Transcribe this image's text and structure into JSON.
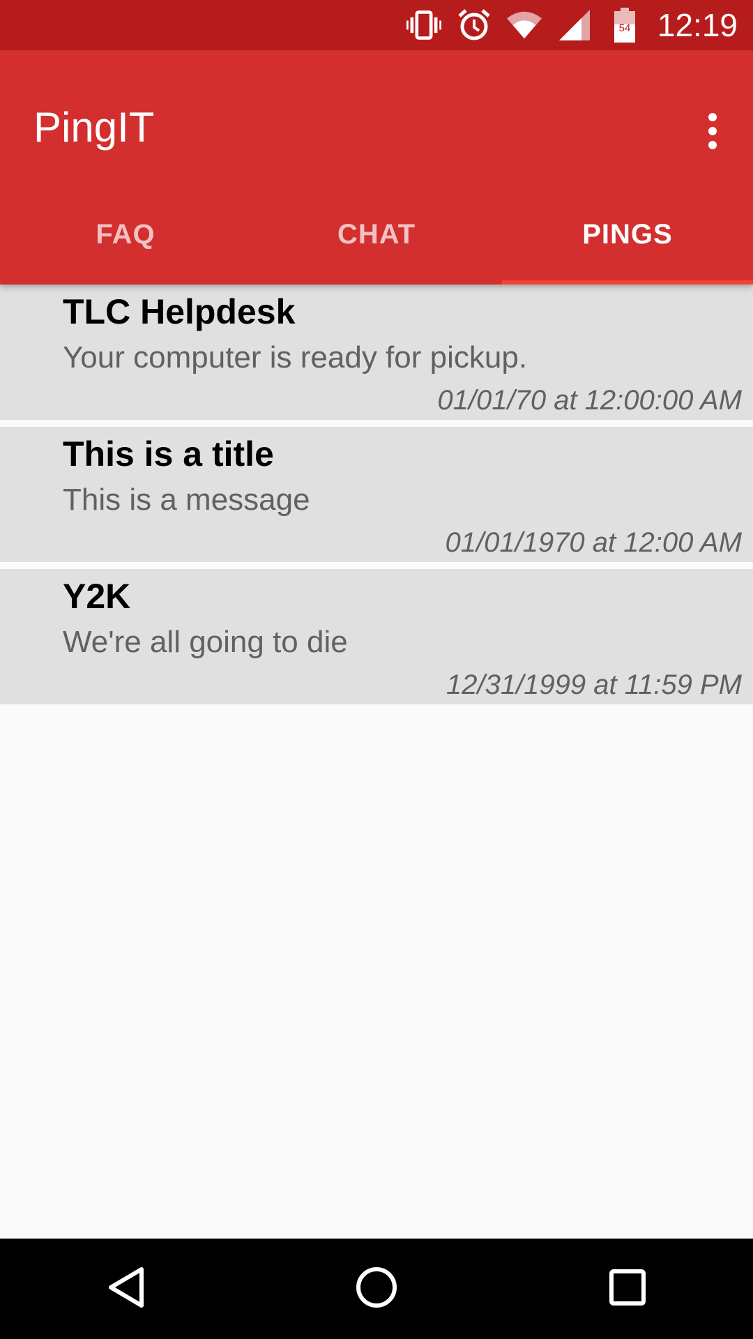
{
  "status_bar": {
    "time": "12:19",
    "battery_level": "54",
    "icons": [
      "vibrate-icon",
      "alarm-icon",
      "wifi-icon",
      "signal-icon",
      "battery-icon"
    ]
  },
  "app_bar": {
    "title": "PingIT",
    "overflow_icon": "more-vert-icon"
  },
  "tabs": [
    {
      "label": "FAQ",
      "active": false
    },
    {
      "label": "CHAT",
      "active": false
    },
    {
      "label": "PINGS",
      "active": true
    }
  ],
  "pings": [
    {
      "title": "TLC Helpdesk",
      "message": "Your computer is ready for pickup.",
      "date": "01/01/70 at 12:00:00 AM"
    },
    {
      "title": "This is a title",
      "message": "This is a message",
      "date": "01/01/1970 at 12:00 AM"
    },
    {
      "title": "Y2K",
      "message": "We're all going to die",
      "date": "12/31/1999 at 11:59 PM"
    }
  ],
  "nav_bar": {
    "icons": [
      "back-icon",
      "home-icon",
      "recents-icon"
    ]
  },
  "colors": {
    "status_bar": "#b71c1c",
    "primary": "#d32f2f",
    "tab_indicator": "#f44336",
    "list_item_bg": "#e0e0e0",
    "background": "#fafafa"
  }
}
